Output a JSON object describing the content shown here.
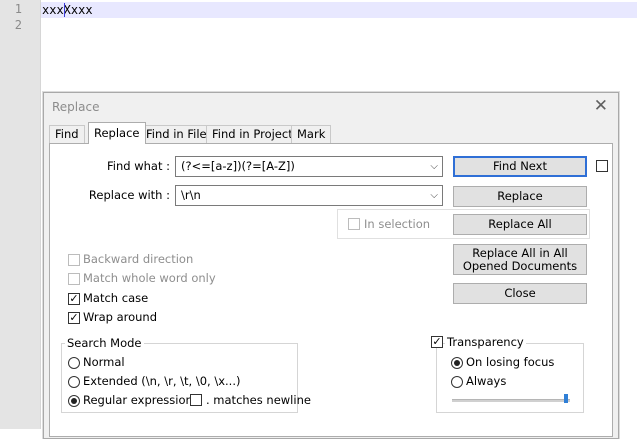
{
  "editor": {
    "line_numbers": [
      "1",
      "2"
    ],
    "lines": [
      "xxxXxxx",
      ""
    ]
  },
  "dialog": {
    "title": "Replace",
    "close_glyph": "✕",
    "tabs": [
      {
        "label": "Find"
      },
      {
        "label": "Replace"
      },
      {
        "label": "Find in Files"
      },
      {
        "label": "Find in Projects"
      },
      {
        "label": "Mark"
      }
    ],
    "find_what_label": "Find what :",
    "find_what_value": "(?<=[a-z])(?=[A-Z])",
    "replace_with_label": "Replace with :",
    "replace_with_value": "\\r\\n",
    "in_selection_label": "In selection",
    "buttons": {
      "find_next": "Find Next",
      "replace": "Replace",
      "replace_all": "Replace All",
      "replace_all_opened": "Replace All in All Opened Documents",
      "close": "Close"
    },
    "options": {
      "backward_direction": "Backward direction",
      "match_whole_word": "Match whole word only",
      "match_case": "Match case",
      "wrap_around": "Wrap around"
    },
    "search_mode": {
      "title": "Search Mode",
      "normal": "Normal",
      "extended": "Extended (\\n, \\r, \\t, \\0, \\x...)",
      "regex": "Regular expression",
      "matches_newline": ". matches newline",
      "selected": "regex"
    },
    "transparency": {
      "title": "Transparency",
      "on_losing_focus": "On losing focus",
      "always": "Always",
      "selected": "on_losing_focus",
      "slider_level_percent": 97
    },
    "check_glyph": "✓",
    "combo_arrow_glyph": "⌵"
  }
}
